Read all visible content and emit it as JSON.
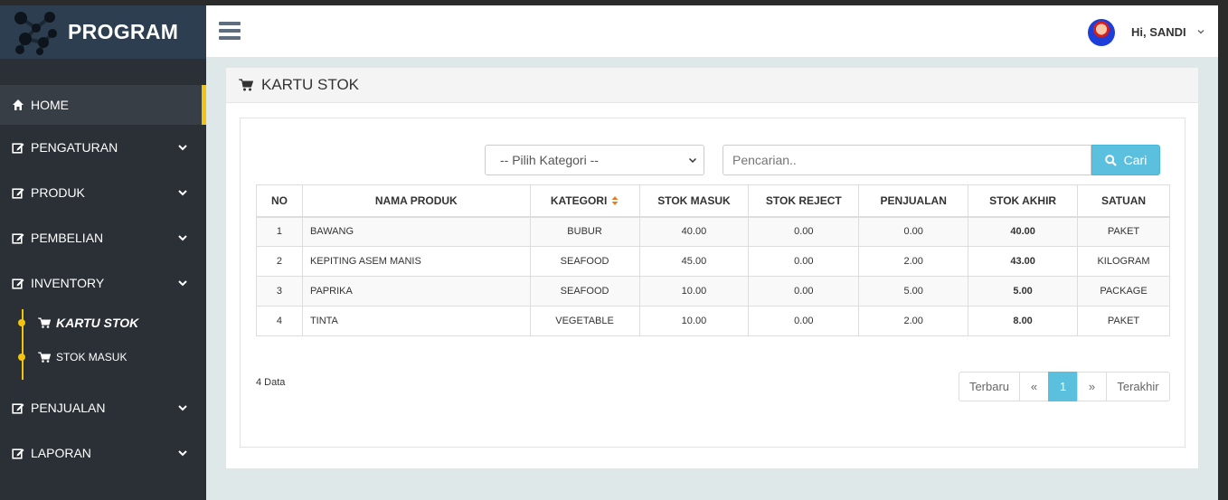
{
  "brand": {
    "name": "PROGRAM"
  },
  "header": {
    "greeting": "Hi, SANDI"
  },
  "sidebar": {
    "items": [
      {
        "label": "HOME",
        "icon": "home-icon",
        "active": true
      },
      {
        "label": "PENGATURAN",
        "icon": "edit-icon"
      },
      {
        "label": "PRODUK",
        "icon": "edit-icon"
      },
      {
        "label": "PEMBELIAN",
        "icon": "edit-icon"
      },
      {
        "label": "INVENTORY",
        "icon": "edit-icon"
      },
      {
        "label": "PENJUALAN",
        "icon": "edit-icon"
      },
      {
        "label": "LAPORAN",
        "icon": "edit-icon"
      }
    ],
    "inventory_sub": [
      {
        "label": "KARTU STOK",
        "icon": "cart-icon",
        "active": true
      },
      {
        "label": "STOK MASUK",
        "icon": "cart-icon"
      }
    ]
  },
  "panel": {
    "title": "KARTU STOK"
  },
  "filters": {
    "category_value": "-- Pilih Kategori --",
    "search_placeholder": "Pencarian..",
    "search_button": "Cari"
  },
  "table": {
    "headers": [
      "NO",
      "NAMA PRODUK",
      "KATEGORI",
      "STOK MASUK",
      "STOK REJECT",
      "PENJUALAN",
      "STOK AKHIR",
      "SATUAN"
    ],
    "rows": [
      [
        "1",
        "BAWANG",
        "BUBUR",
        "40.00",
        "0.00",
        "0.00",
        "40.00",
        "PAKET"
      ],
      [
        "2",
        "KEPITING ASEM MANIS",
        "SEAFOOD",
        "45.00",
        "0.00",
        "2.00",
        "43.00",
        "KILOGRAM"
      ],
      [
        "3",
        "PAPRIKA",
        "SEAFOOD",
        "10.00",
        "0.00",
        "5.00",
        "5.00",
        "PACKAGE"
      ],
      [
        "4",
        "TINTA",
        "VEGETABLE",
        "10.00",
        "0.00",
        "2.00",
        "8.00",
        "PAKET"
      ]
    ]
  },
  "footer": {
    "count": "4 Data"
  },
  "pagination": {
    "first": "Terbaru",
    "prev": "«",
    "current": "1",
    "next": "»",
    "last": "Terakhir"
  },
  "colors": {
    "sidebar": "#2a3036",
    "brand_bar": "#2c3e50",
    "accent": "#f1c40f",
    "info": "#5bc0de",
    "sort": "#e67e22"
  }
}
